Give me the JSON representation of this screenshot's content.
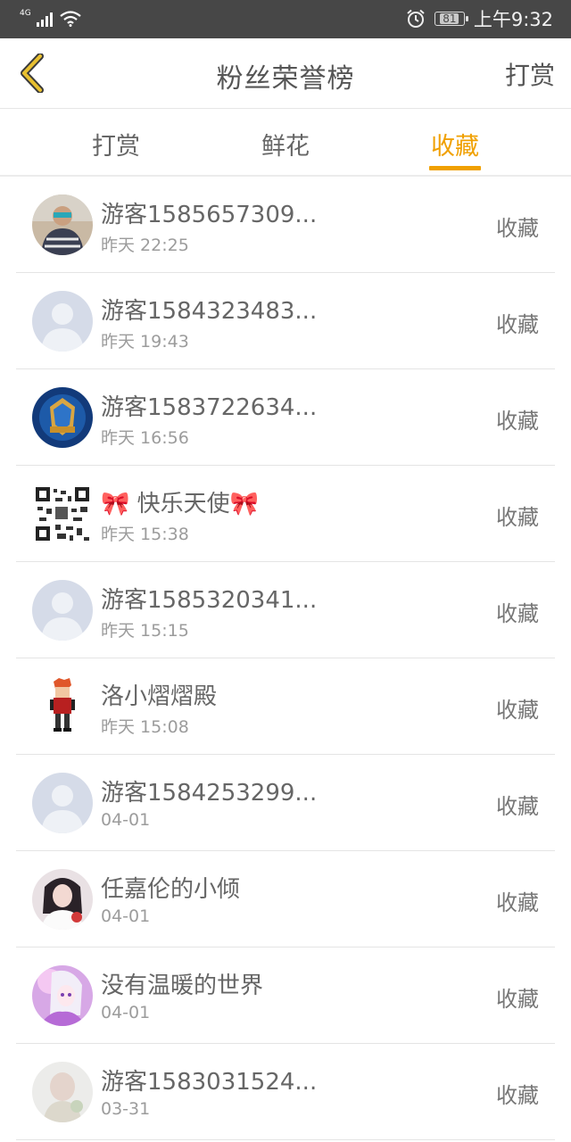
{
  "status_bar": {
    "network": "4G",
    "battery": "81",
    "time": "上午9:32"
  },
  "header": {
    "title": "粉丝荣誉榜",
    "right_label": "打赏"
  },
  "tabs": [
    {
      "label": "打赏"
    },
    {
      "label": "鲜花"
    },
    {
      "label": "收藏"
    }
  ],
  "active_tab": 2,
  "colors": {
    "accent": "#f0a000",
    "status_bar": "#474747",
    "back_arrow": "#e8c030"
  },
  "rows": [
    {
      "name": "游客1585657309...",
      "time": "昨天 22:25",
      "action": "收藏",
      "avatar": "photo-kid"
    },
    {
      "name": "游客1584323483...",
      "time": "昨天 19:43",
      "action": "收藏",
      "avatar": "default-avatar"
    },
    {
      "name": "游客1583722634...",
      "time": "昨天 16:56",
      "action": "收藏",
      "avatar": "game-emblem"
    },
    {
      "name": "🎀 快乐天使🎀",
      "time": "昨天 15:38",
      "action": "收藏",
      "avatar": "qr-code"
    },
    {
      "name": "游客1585320341...",
      "time": "昨天 15:15",
      "action": "收藏",
      "avatar": "default-avatar"
    },
    {
      "name": "洛小熠熠殿",
      "time": "昨天 15:08",
      "action": "收藏",
      "avatar": "pixel-character"
    },
    {
      "name": "游客1584253299...",
      "time": "04-01",
      "action": "收藏",
      "avatar": "default-avatar"
    },
    {
      "name": "任嘉伦的小倾",
      "time": "04-01",
      "action": "收藏",
      "avatar": "photo-girl"
    },
    {
      "name": "没有温暖的世界",
      "time": "04-01",
      "action": "收藏",
      "avatar": "anime-girl"
    },
    {
      "name": "游客1583031524...",
      "time": "03-31",
      "action": "收藏",
      "avatar": "blurred-photo"
    }
  ]
}
